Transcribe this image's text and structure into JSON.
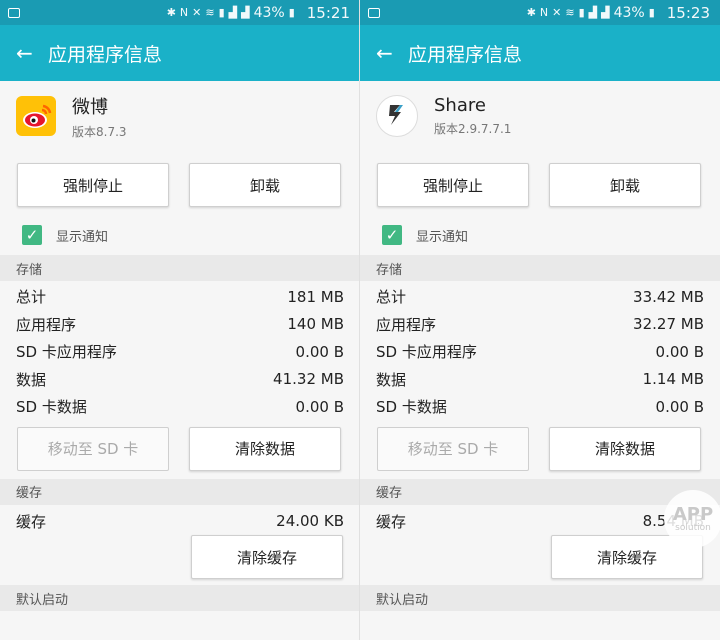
{
  "watermark": {
    "text": "APP",
    "sub": "solution"
  },
  "panels": [
    {
      "status": {
        "time": "15:21",
        "battery": "43%"
      },
      "appbar": {
        "title": "应用程序信息"
      },
      "app": {
        "name": "微博",
        "version": "版本8.7.3"
      },
      "buttons": {
        "force_stop": "强制停止",
        "uninstall": "卸载",
        "move_sd": "移动至 SD 卡",
        "clear_data": "清除数据",
        "clear_cache": "清除缓存"
      },
      "notify": {
        "label": "显示通知"
      },
      "storage": {
        "header": "存储",
        "rows": [
          {
            "label": "总计",
            "value": "181 MB"
          },
          {
            "label": "应用程序",
            "value": "140 MB"
          },
          {
            "label": "SD 卡应用程序",
            "value": "0.00 B"
          },
          {
            "label": "数据",
            "value": "41.32 MB"
          },
          {
            "label": "SD 卡数据",
            "value": "0.00 B"
          }
        ]
      },
      "cache": {
        "header": "缓存",
        "label": "缓存",
        "value": "24.00 KB"
      },
      "default_launch": {
        "header": "默认启动"
      }
    },
    {
      "status": {
        "time": "15:23",
        "battery": "43%"
      },
      "appbar": {
        "title": "应用程序信息"
      },
      "app": {
        "name": "Share",
        "version": "版本2.9.7.7.1"
      },
      "buttons": {
        "force_stop": "强制停止",
        "uninstall": "卸载",
        "move_sd": "移动至 SD 卡",
        "clear_data": "清除数据",
        "clear_cache": "清除缓存"
      },
      "notify": {
        "label": "显示通知"
      },
      "storage": {
        "header": "存储",
        "rows": [
          {
            "label": "总计",
            "value": "33.42 MB"
          },
          {
            "label": "应用程序",
            "value": "32.27 MB"
          },
          {
            "label": "SD 卡应用程序",
            "value": "0.00 B"
          },
          {
            "label": "数据",
            "value": "1.14 MB"
          },
          {
            "label": "SD 卡数据",
            "value": "0.00 B"
          }
        ]
      },
      "cache": {
        "header": "缓存",
        "label": "缓存",
        "value": "8.54 MB"
      },
      "default_launch": {
        "header": "默认启动"
      }
    }
  ]
}
